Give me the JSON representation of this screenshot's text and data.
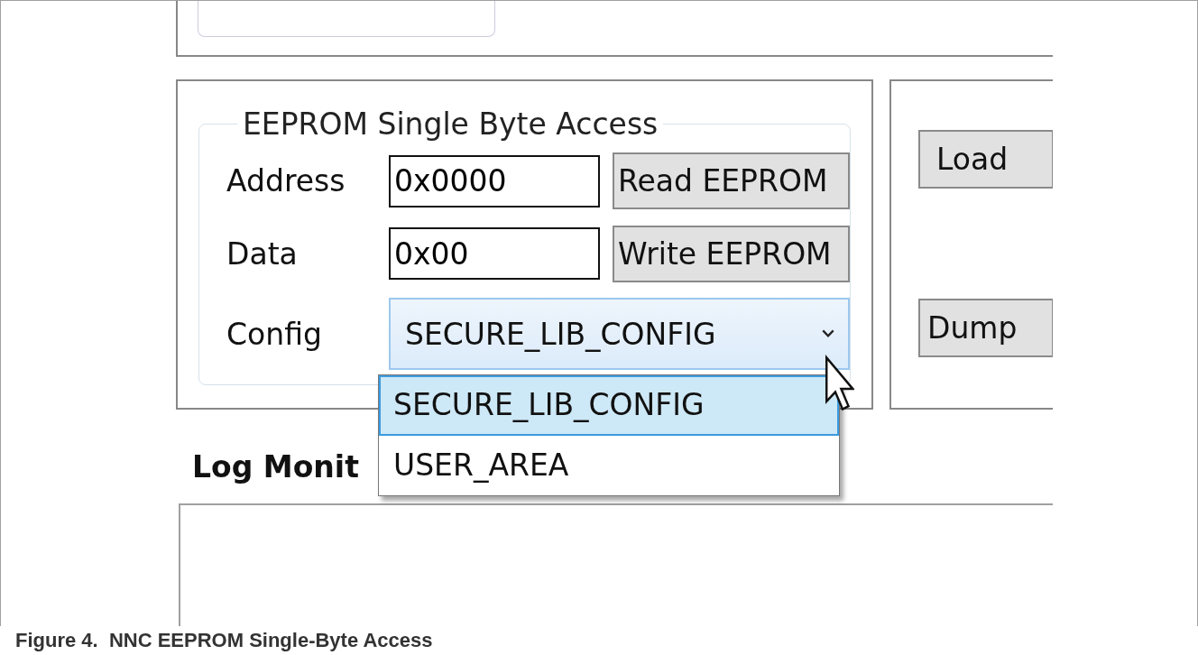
{
  "group": {
    "title": "EEPROM Single Byte Access",
    "fields": [
      {
        "label": "Address",
        "value": "0x0000",
        "button": "Read EEPROM"
      },
      {
        "label": "Data",
        "value": "0x00",
        "button": "Write EEPROM"
      }
    ],
    "config": {
      "label": "Config",
      "value": "SECURE_LIB_CONFIG",
      "expanded": true,
      "options": [
        {
          "label": "SECURE_LIB_CONFIG",
          "selected": true
        },
        {
          "label": "USER_AREA",
          "selected": false
        }
      ]
    }
  },
  "side_buttons": [
    "Load",
    "Dump"
  ],
  "log_monitor": {
    "title": "Log Monit"
  },
  "caption": "Figure 4.  NNC EEPROM Single-Byte Access"
}
